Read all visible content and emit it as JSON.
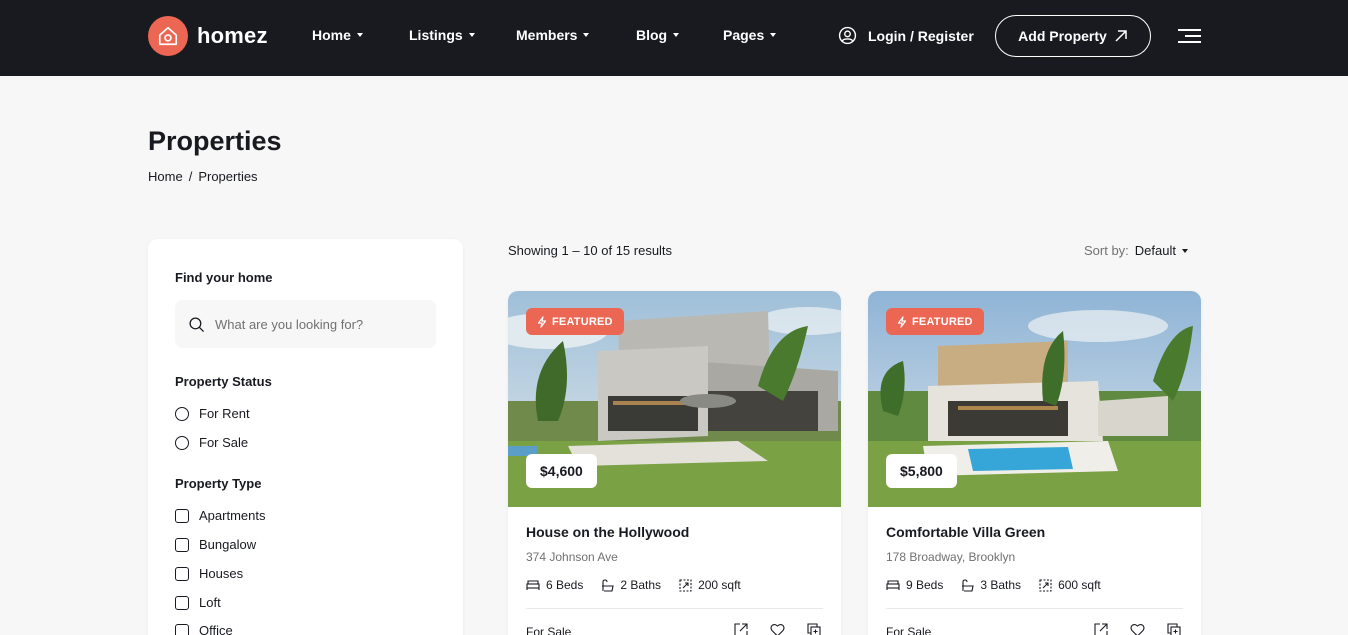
{
  "brand": {
    "name": "homez",
    "accent": "#eb6753",
    "dark": "#181a20"
  },
  "nav": {
    "items": [
      {
        "label": "Home"
      },
      {
        "label": "Listings"
      },
      {
        "label": "Members"
      },
      {
        "label": "Blog"
      },
      {
        "label": "Pages"
      }
    ],
    "login_label": "Login / Register",
    "add_property_label": "Add Property"
  },
  "page": {
    "title": "Properties",
    "breadcrumb": [
      "Home",
      "/",
      "Properties"
    ]
  },
  "sidebar": {
    "find_heading": "Find your home",
    "search_placeholder": "What are you looking for?",
    "status_heading": "Property Status",
    "status_options": [
      "For Rent",
      "For Sale"
    ],
    "type_heading": "Property Type",
    "type_options": [
      "Apartments",
      "Bungalow",
      "Houses",
      "Loft",
      "Office"
    ]
  },
  "results": {
    "showing": "Showing 1 – 10 of 15 results",
    "sort_label": "Sort by:",
    "sort_value": "Default"
  },
  "listings": [
    {
      "badge": "FEATURED",
      "price": "$4,600",
      "title": "House on the Hollywood",
      "address": "374 Johnson Ave",
      "beds": "6 Beds",
      "baths": "2 Baths",
      "area": "200 sqft",
      "status": "For Sale"
    },
    {
      "badge": "FEATURED",
      "price": "$5,800",
      "title": "Comfortable Villa Green",
      "address": "178 Broadway, Brooklyn",
      "beds": "9 Beds",
      "baths": "3 Baths",
      "area": "600 sqft",
      "status": "For Sale"
    }
  ],
  "icons": [
    "home-icon",
    "caret-down-icon",
    "user-icon",
    "arrow-up-right-icon",
    "menu-icon",
    "search-icon",
    "lightning-icon",
    "bed-icon",
    "bath-icon",
    "area-icon",
    "expand-icon",
    "heart-icon",
    "compare-icon"
  ]
}
